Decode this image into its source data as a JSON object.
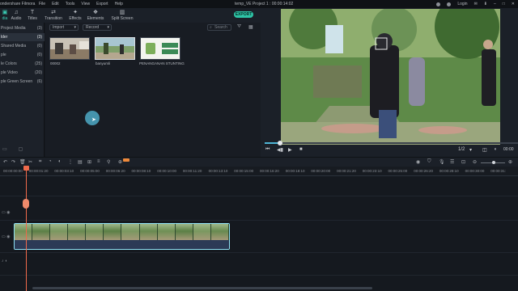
{
  "titlebar": {
    "brand": "ondershare Filmora",
    "menus": [
      "File",
      "Edit",
      "Tools",
      "View",
      "Export",
      "Help"
    ],
    "project": "temp_VE Project 1 : 00:00:14:02",
    "login": "Login"
  },
  "toolbar": {
    "tools": [
      {
        "label": "dia",
        "icon": "▣"
      },
      {
        "label": "Audio",
        "icon": "♫"
      },
      {
        "label": "Titles",
        "icon": "T"
      },
      {
        "label": "Transition",
        "icon": "⇄"
      },
      {
        "label": "Effects",
        "icon": "✦"
      },
      {
        "label": "Elements",
        "icon": "❖"
      },
      {
        "label": "Split Screen",
        "icon": "▥"
      }
    ],
    "export_label": "EXPORT"
  },
  "left_panel": {
    "items": [
      {
        "label": "Project Media",
        "count": "(3)"
      },
      {
        "label": "lder",
        "count": "(3)"
      },
      {
        "label": "Shared Media",
        "count": "(0)"
      },
      {
        "label": "ple",
        "count": "(0)"
      },
      {
        "label": "le Colors",
        "count": "(25)"
      },
      {
        "label": "ple Video",
        "count": "(20)"
      },
      {
        "label": "ple Green Screen",
        "count": "(6)"
      }
    ]
  },
  "media": {
    "import_label": "Import",
    "record_label": "Record",
    "search_placeholder": "Search",
    "thumbnails": [
      {
        "label": "00002"
      },
      {
        "label": "banyumli"
      },
      {
        "label": "PENANGANAN STUNTING"
      }
    ]
  },
  "preview": {
    "ratio": "1/2",
    "timecode": "00:00"
  },
  "timeline": {
    "ruler_labels": [
      "00:00:00:00",
      "00:00:01:20",
      "00:00:03:10",
      "00:00:05:00",
      "00:00:06:20",
      "00:00:08:10",
      "00:00:10:00",
      "00:00:11:20",
      "00:00:13:10",
      "00:00:15:00",
      "00:00:16:20",
      "00:00:18:10",
      "00:00:20:00",
      "00:00:21:20",
      "00:00:23:10",
      "00:00:25:00",
      "00:00:26:20",
      "00:00:28:10",
      "00:00:30:00",
      "00:00:31:"
    ],
    "progress_fraction": 0.06
  },
  "colors": {
    "accent": "#2ec4a6",
    "playhead": "#ef6a4b",
    "clip_border": "#8fe2f5"
  }
}
